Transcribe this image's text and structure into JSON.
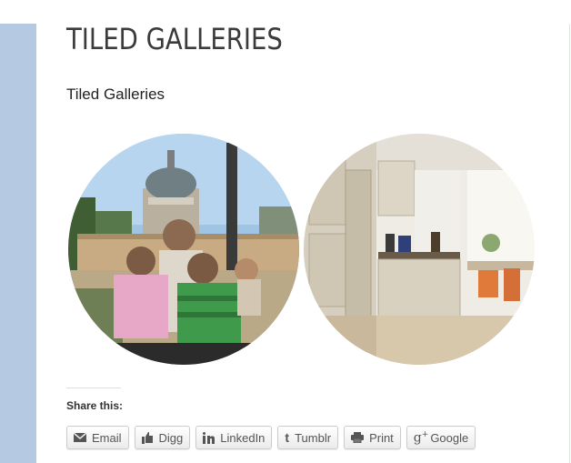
{
  "post": {
    "title": "TILED GALLERIES",
    "subtitle": "Tiled Galleries"
  },
  "gallery": {
    "images": [
      {
        "name": "family-photo-church"
      },
      {
        "name": "kitchen-photo"
      }
    ]
  },
  "share": {
    "label": "Share this:",
    "buttons": [
      {
        "label": "Email",
        "icon": "email-icon"
      },
      {
        "label": "Digg",
        "icon": "thumbs-up-icon"
      },
      {
        "label": "LinkedIn",
        "icon": "linkedin-icon"
      },
      {
        "label": "Tumblr",
        "icon": "tumblr-icon"
      },
      {
        "label": "Print",
        "icon": "printer-icon"
      },
      {
        "label": "Google",
        "icon": "google-plus-icon"
      }
    ]
  }
}
